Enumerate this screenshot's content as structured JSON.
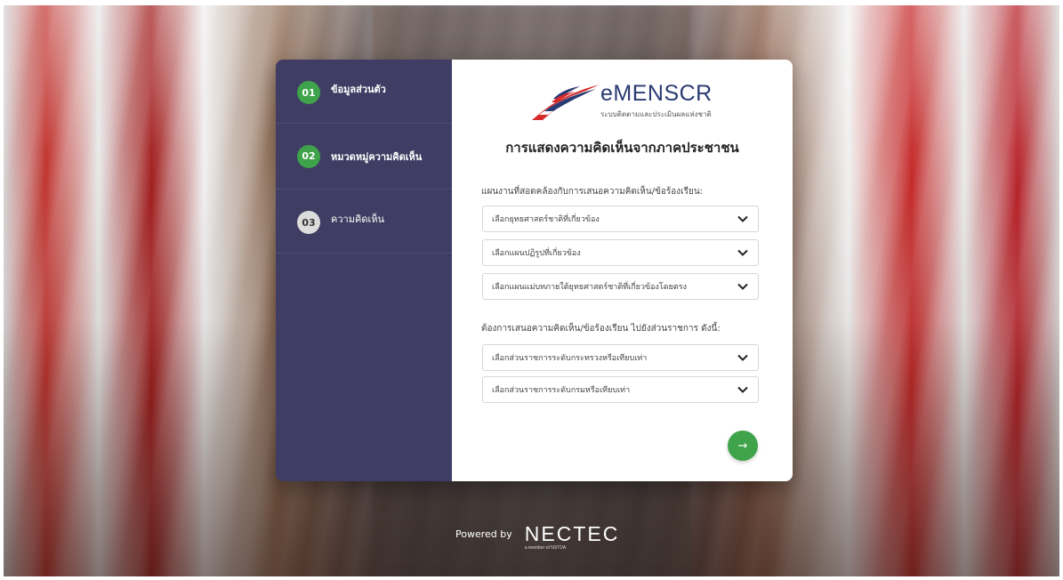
{
  "steps": [
    {
      "number": "01",
      "label": "ข้อมูลส่วนตัว",
      "status": "done"
    },
    {
      "number": "02",
      "label": "หมวดหมู่ความคิดเห็น",
      "status": "done"
    },
    {
      "number": "03",
      "label": "ความคิดเห็น",
      "status": "todo"
    }
  ],
  "logo": {
    "title": "eMENSCR",
    "subtitle": "ระบบติดตามและประเมินผลแห่งชาติ"
  },
  "form": {
    "heading": "การแสดงความคิดเห็นจากภาคประชาชน",
    "section1_label": "แผนงานที่สอดคล้องกับการเสนอความคิดเห็น/ข้อร้องเรียน:",
    "section2_label": "ต้องการเสนอความคิดเห็น/ข้อร้องเรียน ไปยังส่วนราชการ ดังนี้:",
    "selects": [
      "เลือกยุทธศาสตร์ชาติที่เกี่ยวข้อง",
      "เลือกแผนปฏิรูปที่เกี่ยวข้อง",
      "เลือกแผนแม่บทภายใต้ยุทธศาสตร์ชาติที่เกี่ยวข้องโดยตรง",
      "เลือกส่วนราชการระดับกระทรวงหรือเทียบเท่า",
      "เลือกส่วนราชการระดับกรมหรือเทียบเท่า"
    ],
    "next_label": "→"
  },
  "footer": {
    "powered_by": "Powered by",
    "brand": "NECTEC",
    "brand_sub": "a member of NSTDA"
  },
  "colors": {
    "sidebar": "#3f3d63",
    "accent_green": "#3ea34a",
    "heading_text": "#222222"
  }
}
